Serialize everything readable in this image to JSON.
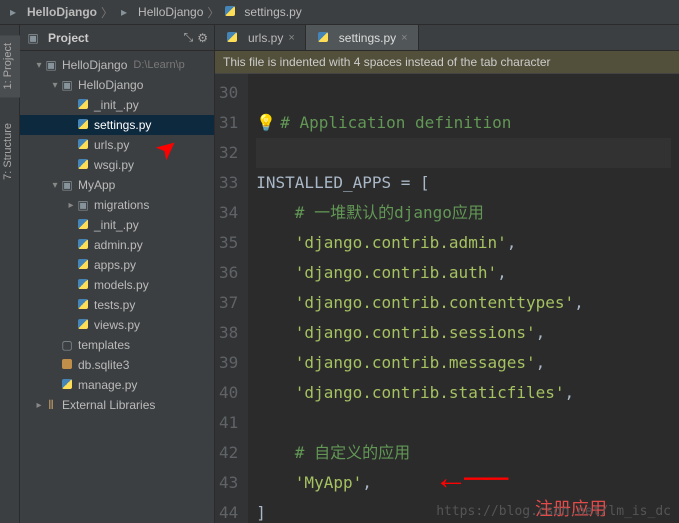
{
  "breadcrumb": [
    {
      "label": "HelloDjango",
      "kind": "project"
    },
    {
      "label": "HelloDjango",
      "kind": "folder"
    },
    {
      "label": "settings.py",
      "kind": "py"
    }
  ],
  "project_panel": {
    "title": "Project"
  },
  "side_tools": {
    "project": "1: Project",
    "structure": "7: Structure"
  },
  "tabs": [
    {
      "label": "urls.py",
      "active": false,
      "kind": "py"
    },
    {
      "label": "settings.py",
      "active": true,
      "kind": "py"
    }
  ],
  "tree": [
    {
      "depth": 0,
      "arrow": "down",
      "icon": "proj",
      "label": "HelloDjango",
      "hint": "D:\\Learn\\p",
      "sel": false
    },
    {
      "depth": 1,
      "arrow": "down",
      "icon": "pkg",
      "label": "HelloDjango",
      "sel": false
    },
    {
      "depth": 2,
      "arrow": "",
      "icon": "py",
      "label": "_init_.py",
      "sel": false
    },
    {
      "depth": 2,
      "arrow": "",
      "icon": "py",
      "label": "settings.py",
      "sel": true
    },
    {
      "depth": 2,
      "arrow": "",
      "icon": "py",
      "label": "urls.py",
      "sel": false
    },
    {
      "depth": 2,
      "arrow": "",
      "icon": "py",
      "label": "wsgi.py",
      "sel": false
    },
    {
      "depth": 1,
      "arrow": "down",
      "icon": "pkg",
      "label": "MyApp",
      "sel": false
    },
    {
      "depth": 2,
      "arrow": "right",
      "icon": "pkg",
      "label": "migrations",
      "sel": false
    },
    {
      "depth": 2,
      "arrow": "",
      "icon": "py",
      "label": "_init_.py",
      "sel": false
    },
    {
      "depth": 2,
      "arrow": "",
      "icon": "py",
      "label": "admin.py",
      "sel": false
    },
    {
      "depth": 2,
      "arrow": "",
      "icon": "py",
      "label": "apps.py",
      "sel": false
    },
    {
      "depth": 2,
      "arrow": "",
      "icon": "py",
      "label": "models.py",
      "sel": false
    },
    {
      "depth": 2,
      "arrow": "",
      "icon": "py",
      "label": "tests.py",
      "sel": false
    },
    {
      "depth": 2,
      "arrow": "",
      "icon": "py",
      "label": "views.py",
      "sel": false
    },
    {
      "depth": 1,
      "arrow": "",
      "icon": "folder",
      "label": "templates",
      "sel": false
    },
    {
      "depth": 1,
      "arrow": "",
      "icon": "db",
      "label": "db.sqlite3",
      "sel": false
    },
    {
      "depth": 1,
      "arrow": "",
      "icon": "py",
      "label": "manage.py",
      "sel": false
    },
    {
      "depth": 0,
      "arrow": "right",
      "icon": "lib",
      "label": "External Libraries",
      "sel": false
    }
  ],
  "editor": {
    "warning": "This file is indented with 4 spaces instead of the tab character",
    "first_line_no": 30,
    "lines": [
      {
        "n": 30,
        "segs": []
      },
      {
        "n": 31,
        "segs": [
          {
            "t": "# ",
            "c": "comment-green",
            "bulb": true
          },
          {
            "t": "Application definition",
            "c": "comment-green"
          }
        ]
      },
      {
        "n": 32,
        "segs": [],
        "current": true
      },
      {
        "n": 33,
        "segs": [
          {
            "t": "INSTALLED_APPS ",
            "c": "op"
          },
          {
            "t": "= [",
            "c": "op"
          }
        ]
      },
      {
        "n": 34,
        "segs": [
          {
            "t": "    ",
            "c": "op"
          },
          {
            "t": "# 一堆默认的django应用",
            "c": "comment-green"
          }
        ]
      },
      {
        "n": 35,
        "segs": [
          {
            "t": "    ",
            "c": "op"
          },
          {
            "t": "'django.contrib.admin'",
            "c": "str"
          },
          {
            "t": ",",
            "c": "op"
          }
        ]
      },
      {
        "n": 36,
        "segs": [
          {
            "t": "    ",
            "c": "op"
          },
          {
            "t": "'django.contrib.auth'",
            "c": "str"
          },
          {
            "t": ",",
            "c": "op"
          }
        ]
      },
      {
        "n": 37,
        "segs": [
          {
            "t": "    ",
            "c": "op"
          },
          {
            "t": "'django.contrib.contenttypes'",
            "c": "str"
          },
          {
            "t": ",",
            "c": "op"
          }
        ]
      },
      {
        "n": 38,
        "segs": [
          {
            "t": "    ",
            "c": "op"
          },
          {
            "t": "'django.contrib.sessions'",
            "c": "str"
          },
          {
            "t": ",",
            "c": "op"
          }
        ]
      },
      {
        "n": 39,
        "segs": [
          {
            "t": "    ",
            "c": "op"
          },
          {
            "t": "'django.contrib.messages'",
            "c": "str"
          },
          {
            "t": ",",
            "c": "op"
          }
        ]
      },
      {
        "n": 40,
        "segs": [
          {
            "t": "    ",
            "c": "op"
          },
          {
            "t": "'django.contrib.staticfiles'",
            "c": "str"
          },
          {
            "t": ",",
            "c": "op"
          }
        ]
      },
      {
        "n": 41,
        "segs": []
      },
      {
        "n": 42,
        "segs": [
          {
            "t": "    ",
            "c": "op"
          },
          {
            "t": "# 自定义的应用",
            "c": "comment-green"
          }
        ]
      },
      {
        "n": 43,
        "segs": [
          {
            "t": "    ",
            "c": "op"
          },
          {
            "t": "'MyApp'",
            "c": "str"
          },
          {
            "t": ",",
            "c": "op"
          }
        ]
      },
      {
        "n": 44,
        "segs": [
          {
            "t": "]",
            "c": "op"
          }
        ]
      }
    ]
  },
  "annotations": {
    "register_app": "注册应用",
    "watermark": "https://blog.csdn.net/lm_is_dc"
  }
}
